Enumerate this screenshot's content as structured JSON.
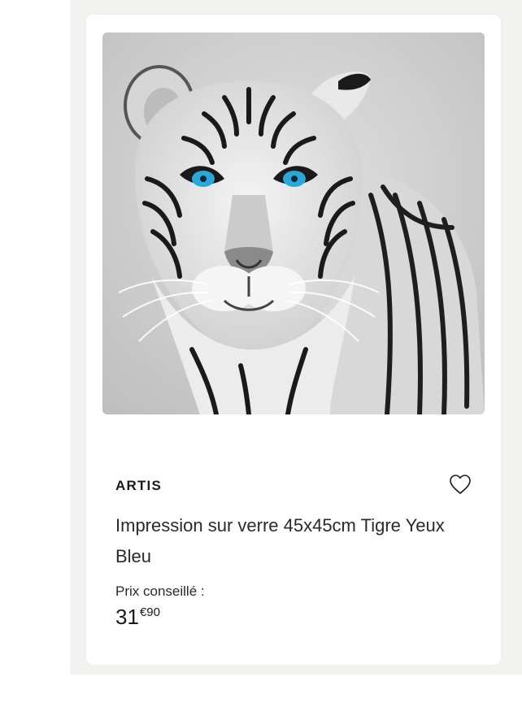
{
  "product": {
    "brand": "ARTIS",
    "title": "Impression sur verre 45x45cm Tigre Yeux Bleu",
    "price_label": "Prix conseillé :",
    "price_integer": "31",
    "price_decimal": "€90",
    "image_subject": "white tiger with blue eyes"
  },
  "icons": {
    "wishlist": "heart-icon"
  },
  "colors": {
    "eye_blue": "#2aa8d8",
    "text_dark": "#1a1a1a",
    "page_bg": "#f2f2f0"
  }
}
